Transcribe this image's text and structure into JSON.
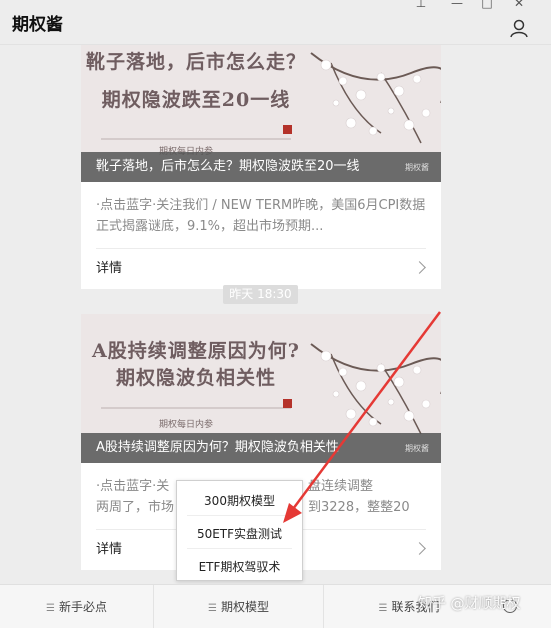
{
  "window": {
    "title": "期权酱",
    "controls": {
      "pin": "⊥",
      "minimize": "—",
      "maximize": "□",
      "close": "✕"
    }
  },
  "messages": [
    {
      "banner_line1": "靴子落地，后市怎么走？",
      "banner_line2": "期权隐波跌至20一线",
      "banner_sub": "期权每日内参",
      "caption": "靴子落地，后市怎么走？期权隐波跌至20一线",
      "caption_watermark": "期权酱",
      "desc": "·点击蓝字·关注我们 / NEW TERM昨晚，美国6月CPI数据正式揭露谜底，9.1%，超出市场预期...",
      "more": "详情"
    },
    {
      "banner_line1": "A股持续调整原因为何?",
      "banner_line2": "期权隐波负相关性",
      "banner_sub": "期权每日内参",
      "caption": "A股持续调整原因为何？期权隐波负相关性",
      "caption_watermark": "期权酱",
      "desc_line1_left": "·点击蓝字·关",
      "desc_line1_right": "盘连续调整",
      "desc_line2_left": "两周了，市场",
      "desc_line2_right": "到3228，整整20",
      "more": "详情"
    }
  ],
  "time_badge": "昨天  18:30",
  "popup_menu": [
    "300期权模型",
    "50ETF实盘测试",
    "ETF期权驾驭术"
  ],
  "bottom_menu": [
    "新手必点",
    "期权模型",
    "联系我们"
  ],
  "watermark": "知乎 @财顺期权",
  "colors": {
    "arrow": "#e53935",
    "caption_bg": "#555555",
    "banner_text": "#6f5d60"
  }
}
